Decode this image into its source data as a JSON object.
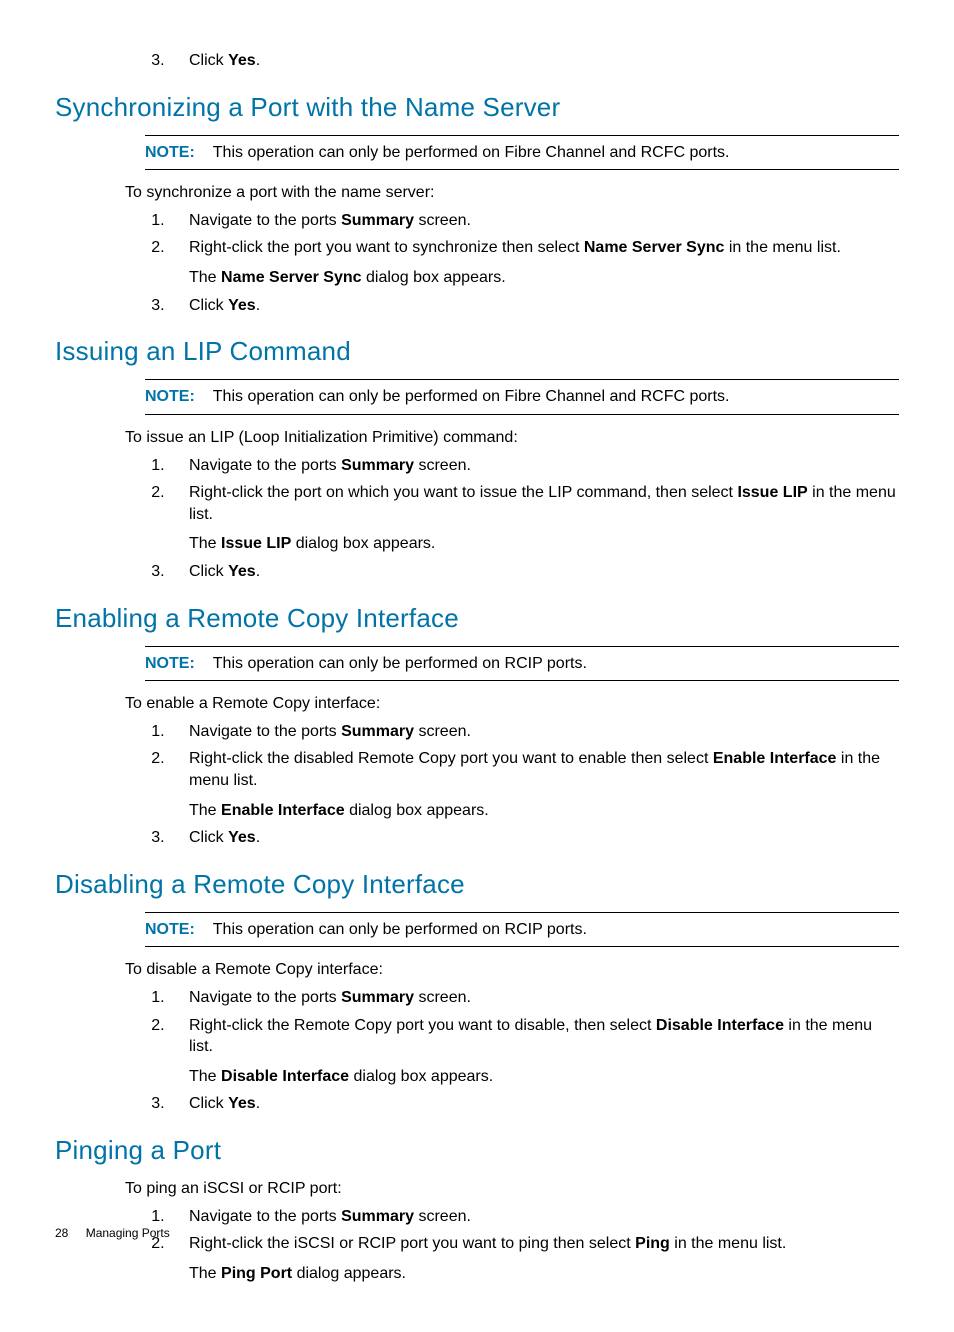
{
  "topstep": {
    "n": "3",
    "p1": "Click ",
    "b": "Yes",
    "p2": "."
  },
  "s1": {
    "heading": "Synchronizing a Port with the Name Server",
    "note_label": "NOTE:",
    "note_text": "This operation can only be performed on Fibre Channel and RCFC ports.",
    "intro": "To synchronize a port with the name server:",
    "step1": {
      "p1": "Navigate to the ports ",
      "b": "Summary",
      "p2": " screen."
    },
    "step2": {
      "p1": "Right-click the port you want to synchronize then select ",
      "b": "Name Server Sync",
      "p2": " in the menu list.",
      "sub_p1": "The ",
      "sub_b": "Name Server Sync",
      "sub_p2": " dialog box appears."
    },
    "step3": {
      "p1": "Click ",
      "b": "Yes",
      "p2": "."
    }
  },
  "s2": {
    "heading": "Issuing an LIP Command",
    "note_label": "NOTE:",
    "note_text": "This operation can only be performed on Fibre Channel and RCFC ports.",
    "intro": "To issue an LIP (Loop Initialization Primitive) command:",
    "step1": {
      "p1": "Navigate to the ports ",
      "b": "Summary",
      "p2": " screen."
    },
    "step2": {
      "p1": "Right-click the port on which you want to issue the LIP command, then select ",
      "b": "Issue LIP",
      "p2": " in the menu list.",
      "sub_p1": "The ",
      "sub_b": "Issue LIP",
      "sub_p2": " dialog box appears."
    },
    "step3": {
      "p1": "Click ",
      "b": "Yes",
      "p2": "."
    }
  },
  "s3": {
    "heading": "Enabling a Remote Copy Interface",
    "note_label": "NOTE:",
    "note_text": "This operation can only be performed on RCIP ports.",
    "intro": "To enable a Remote Copy interface:",
    "step1": {
      "p1": "Navigate to the ports ",
      "b": "Summary",
      "p2": " screen."
    },
    "step2": {
      "p1": "Right-click the disabled Remote Copy port you want to enable then select ",
      "b": "Enable Interface",
      "p2": " in the menu list.",
      "sub_p1": "The ",
      "sub_b": "Enable Interface",
      "sub_p2": " dialog box appears."
    },
    "step3": {
      "p1": "Click ",
      "b": "Yes",
      "p2": "."
    }
  },
  "s4": {
    "heading": "Disabling a Remote Copy Interface",
    "note_label": "NOTE:",
    "note_text": "This operation can only be performed on RCIP ports.",
    "intro": "To disable a Remote Copy interface:",
    "step1": {
      "p1": "Navigate to the ports ",
      "b": "Summary",
      "p2": " screen."
    },
    "step2": {
      "p1": "Right-click the Remote Copy port you want to disable, then select ",
      "b": "Disable Interface",
      "p2": " in the menu list.",
      "sub_p1": "The ",
      "sub_b": "Disable Interface",
      "sub_p2": " dialog box appears."
    },
    "step3": {
      "p1": "Click ",
      "b": "Yes",
      "p2": "."
    }
  },
  "s5": {
    "heading": "Pinging a Port",
    "intro": "To ping an iSCSI or RCIP port:",
    "step1": {
      "p1": "Navigate to the ports ",
      "b": "Summary",
      "p2": " screen."
    },
    "step2": {
      "p1": "Right-click the iSCSI or RCIP port you want to ping then select ",
      "b": "Ping",
      "p2": " in the menu list.",
      "sub_p1": "The ",
      "sub_b": "Ping Port",
      "sub_p2": " dialog appears."
    }
  },
  "footer": {
    "page": "28",
    "title": "Managing Ports"
  }
}
